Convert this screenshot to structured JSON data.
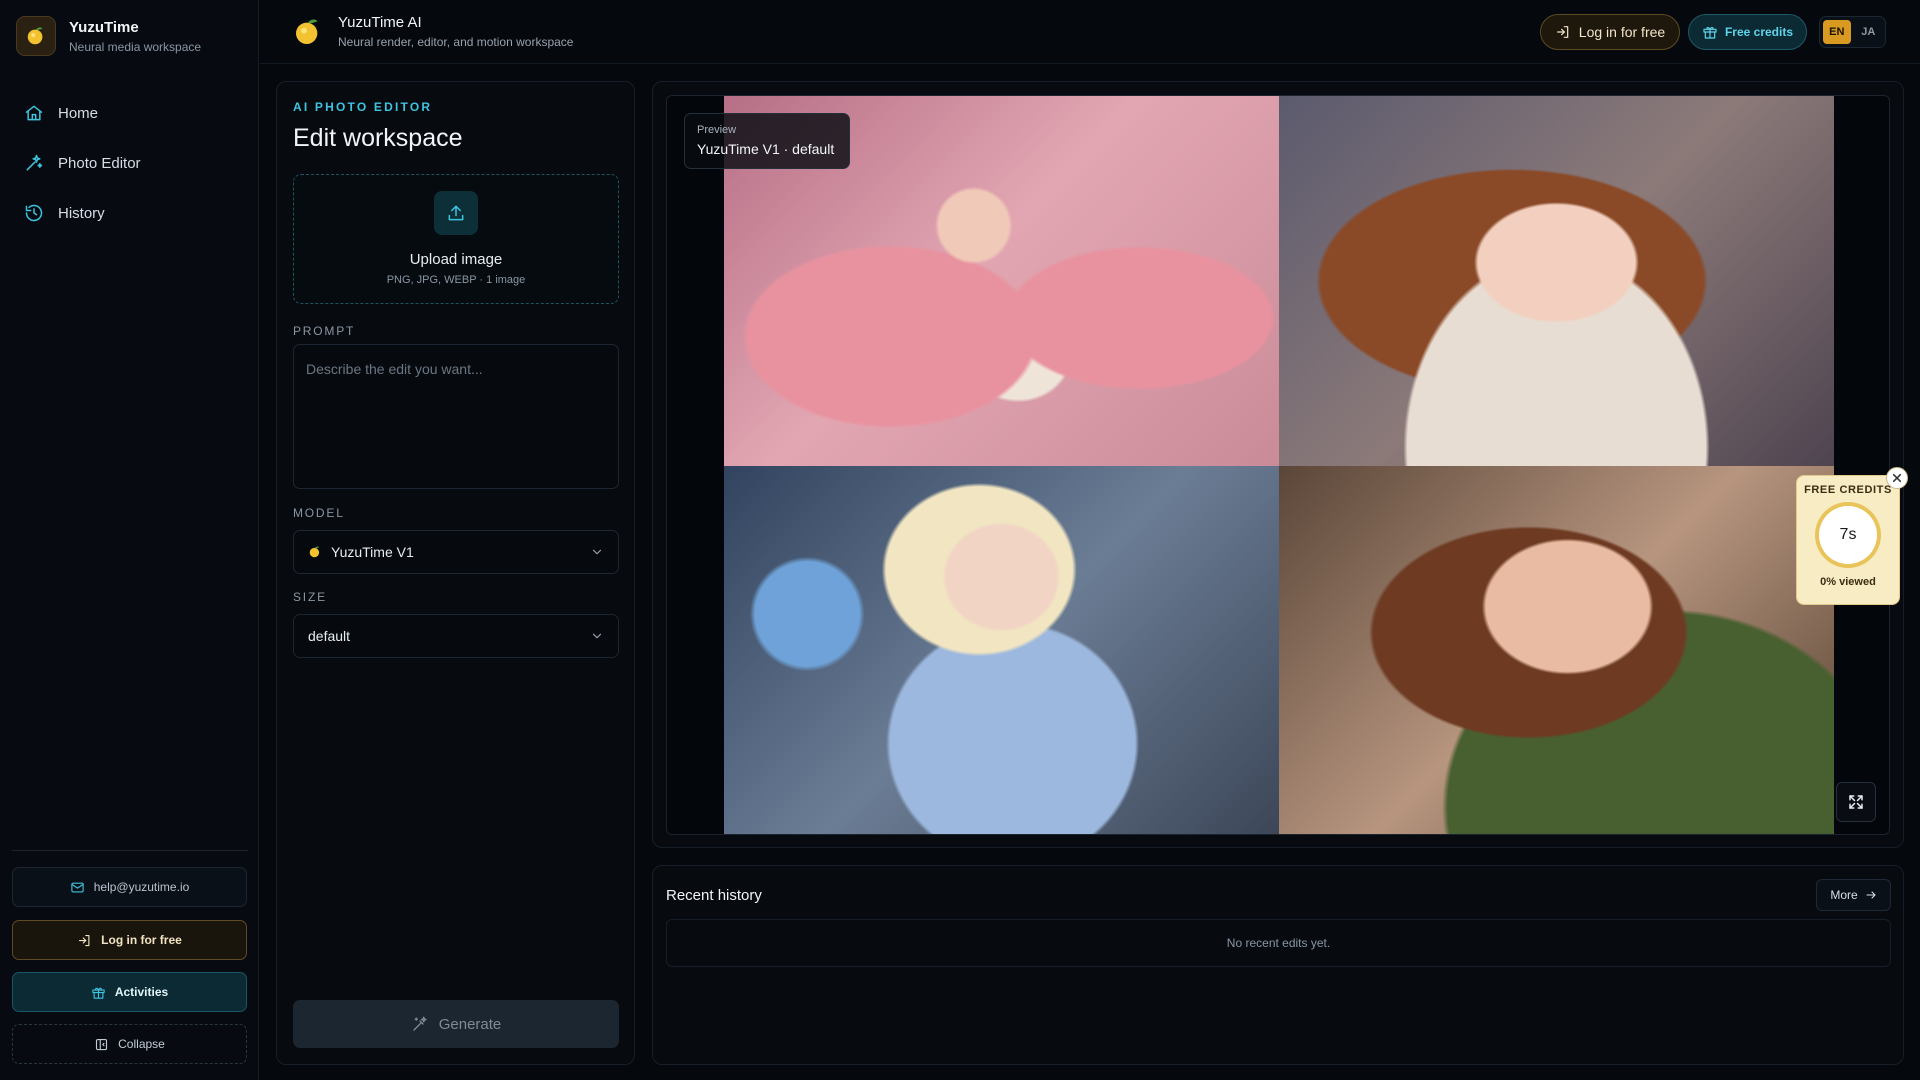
{
  "colors": {
    "accent_cyan": "#3fc3df",
    "accent_gold": "#d99a22",
    "background": "#05080d",
    "panel": "#070b10"
  },
  "sidebar": {
    "brand_title": "YuzuTime",
    "brand_subtitle": "Neural media workspace",
    "nav": [
      {
        "label": "Home",
        "icon": "home-icon"
      },
      {
        "label": "Photo Editor",
        "icon": "sparkle-icon"
      },
      {
        "label": "History",
        "icon": "history-icon"
      }
    ],
    "email": "help@yuzutime.io",
    "login_label": "Log in for free",
    "activities_label": "Activities",
    "collapse_label": "Collapse"
  },
  "header": {
    "title": "YuzuTime AI",
    "subtitle": "Neural render, editor, and motion workspace",
    "login_label": "Log in for free",
    "credits_label": "Free credits",
    "languages": [
      "EN",
      "JA"
    ],
    "active_language": "EN"
  },
  "editor": {
    "eyebrow": "AI PHOTO EDITOR",
    "title": "Edit workspace",
    "upload_title": "Upload image",
    "upload_hint": "PNG, JPG, WEBP · 1 image",
    "prompt_label": "PROMPT",
    "prompt_placeholder": "Describe the edit you want...",
    "prompt_value": "",
    "model_label": "MODEL",
    "model_value": "YuzuTime V1",
    "size_label": "SIZE",
    "size_value": "default",
    "generate_label": "Generate"
  },
  "preview": {
    "tag_label": "Preview",
    "tag_value": "YuzuTime V1 · default"
  },
  "credit_widget": {
    "title": "FREE CREDITS",
    "countdown": "7s",
    "viewed": "0% viewed"
  },
  "history": {
    "title": "Recent history",
    "more_label": "More",
    "empty_text": "No recent edits yet."
  }
}
